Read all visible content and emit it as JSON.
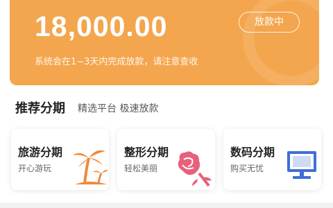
{
  "loan": {
    "amount": "18,000.00",
    "status": "放款中",
    "notice": "系统会在1~3天内完成放款，请注意查收"
  },
  "section": {
    "title": "推荐分期",
    "subtitle": "精选平台 极速放款"
  },
  "cards": [
    {
      "title": "旅游分期",
      "subtitle": "开心游玩",
      "icon": "palm-tree-icon"
    },
    {
      "title": "整形分期",
      "subtitle": "轻松美丽",
      "icon": "rose-icon"
    },
    {
      "title": "数码分期",
      "subtitle": "购买无忧",
      "icon": "monitor-icon"
    }
  ],
  "colors": {
    "hero": "#f3a64e",
    "palm": "#f08a3c",
    "rose": "#e8607a",
    "monitor": "#3f6fd8"
  }
}
